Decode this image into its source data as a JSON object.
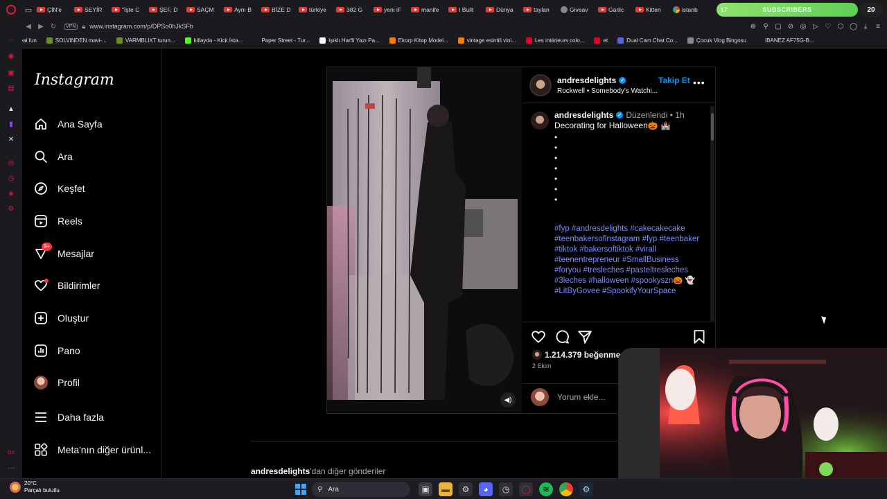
{
  "browser": {
    "tabs": [
      {
        "label": "ÇİN'e",
        "icon": "youtube-icon"
      },
      {
        "label": "SEYİR",
        "icon": "youtube-icon"
      },
      {
        "label": "\"İşte C",
        "icon": "youtube-icon"
      },
      {
        "label": "ŞEF, D",
        "icon": "youtube-icon"
      },
      {
        "label": "SAÇM",
        "icon": "youtube-icon"
      },
      {
        "label": "Aynı B",
        "icon": "youtube-icon"
      },
      {
        "label": "BİZE D",
        "icon": "youtube-icon"
      },
      {
        "label": "türkiye",
        "icon": "youtube-icon"
      },
      {
        "label": "382 G",
        "icon": "youtube-icon"
      },
      {
        "label": "yeni iF",
        "icon": "youtube-icon"
      },
      {
        "label": "manife",
        "icon": "youtube-icon"
      },
      {
        "label": "I Built",
        "icon": "youtube-icon"
      },
      {
        "label": "Dünya",
        "icon": "youtube-icon"
      },
      {
        "label": "taylan",
        "icon": "youtube-icon"
      },
      {
        "label": "Giveav",
        "icon": "site-icon"
      },
      {
        "label": "Garlic",
        "icon": "youtube-icon"
      },
      {
        "label": "Kitten",
        "icon": "youtube-icon"
      },
      {
        "label": "istanb",
        "icon": "google-icon"
      }
    ],
    "subscribers_label": "SUBSCRIBERS",
    "subscribers_progress_label": "17",
    "subscribers_count": "20",
    "vpn": "VPN",
    "url": "www.instagram.com/p/DPSo0hJkSFb",
    "bookmarks": [
      {
        "label": "Neal.fun",
        "color": "#444"
      },
      {
        "label": "SOLVINDEN mavi-...",
        "color": "#6b8e23"
      },
      {
        "label": "VARMBLIXT turun...",
        "color": "#6b8e23"
      },
      {
        "label": "killayda - Kick İsta...",
        "color": "#53fc18"
      },
      {
        "label": "Paper Street - Tur...",
        "color": "#1b1b1f"
      },
      {
        "label": "Işıklı Harfli Yazı Pa...",
        "color": "#ffffff"
      },
      {
        "label": "Ekorp Kitap Model...",
        "color": "#f57c00"
      },
      {
        "label": "vintage esintili vini...",
        "color": "#f57c00"
      },
      {
        "label": "Les intérieurs colo...",
        "color": "#e60023"
      },
      {
        "label": "et",
        "color": "#e60023"
      },
      {
        "label": "Dual Cam Chat Co...",
        "color": "#5566dd"
      },
      {
        "label": "Çocuk Vlog Bingosu",
        "color": "#888888"
      },
      {
        "label": "IBANEZ AF75G-B...",
        "color": "#1b1b1f"
      }
    ]
  },
  "sidebar": {
    "logo": "Instagram",
    "items": [
      {
        "label": "Ana Sayfa",
        "icon": "home-icon"
      },
      {
        "label": "Ara",
        "icon": "search-icon"
      },
      {
        "label": "Keşfet",
        "icon": "compass-icon"
      },
      {
        "label": "Reels",
        "icon": "reels-icon"
      },
      {
        "label": "Mesajlar",
        "icon": "messenger-icon",
        "badge": "9+"
      },
      {
        "label": "Bildirimler",
        "icon": "heart-icon"
      },
      {
        "label": "Oluştur",
        "icon": "plus-square-icon"
      },
      {
        "label": "Pano",
        "icon": "dashboard-icon"
      },
      {
        "label": "Profil",
        "icon": "avatar-icon"
      },
      {
        "label": "Daha fazla",
        "icon": "menu-icon"
      },
      {
        "label": "Meta'nın diğer ürünl...",
        "icon": "meta-apps-icon"
      }
    ]
  },
  "post": {
    "username": "andresdelights",
    "follow_label": "Takip Et",
    "audio": "Rockwell • Somebody's Watchi...",
    "caption_user": "andresdelights",
    "caption_meta": "Düzenlendi • 1h",
    "caption_text": "Decorating for Halloween🎃 🏰",
    "bullets": [
      "•",
      "•",
      "•",
      "•",
      "•",
      "•",
      "•"
    ],
    "hashtags": "#fyp #andresdelights #cakecakecake #teenbakersofinstagram #fyp #teenbaker #tiktok #bakersoftiktok #virall #teenentrepreneur #SmallBusiness #foryou #tresleches #pasteltresleches #3leches #halloween #spookyszn🎃 👻 #LitByGovee #SpookifyYourSpace",
    "likes": "1.214.379 beğenme",
    "date": "2 Ekim",
    "comment_placeholder": "Yorum ekle..."
  },
  "more_posts": {
    "user": "andresdelights",
    "suffix": "'dan diğer gönderiler"
  },
  "taskbar": {
    "temperature": "20°C",
    "weather": "Parçalı bulutlu",
    "search_placeholder": "Ara"
  }
}
